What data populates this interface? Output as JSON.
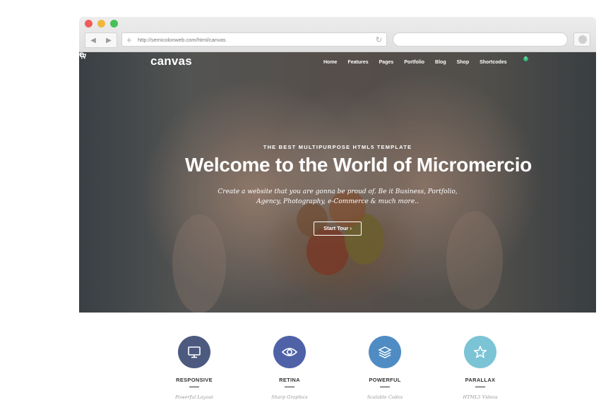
{
  "browser": {
    "url": "http://semicolonweb.com/html/canvas",
    "traffic_lights": {
      "close": "#ee5d5a",
      "minimize": "#f0b73e",
      "zoom": "#45c157"
    }
  },
  "site": {
    "logo": "canvas",
    "menu": [
      "Home",
      "Features",
      "Pages",
      "Portfolio",
      "Blog",
      "Shop",
      "Shortcodes"
    ],
    "cart_count": "5"
  },
  "hero": {
    "kicker": "THE BEST MULTIPURPOSE HTML5 TEMPLATE",
    "headline": "Welcome to the World of Micromercio",
    "subline_1": "Create a website that you are gonna be proud of. Be it Business, Portfolio,",
    "subline_2": "Agency, Photography, e-Commerce & much more..",
    "cta_label": "Start Tour",
    "cta_icon": "chevron-right-icon"
  },
  "features": [
    {
      "title": "RESPONSIVE",
      "desc": "Powerful Layout",
      "icon": "monitor-icon",
      "color": "#4d5a80"
    },
    {
      "title": "RETINA",
      "desc": "Sharp Graphics",
      "icon": "eye-icon",
      "color": "#4f62a8"
    },
    {
      "title": "POWERFUL",
      "desc": "Scalable Codes",
      "icon": "layers-icon",
      "color": "#4f8cc4"
    },
    {
      "title": "PARALLAX",
      "desc": "HTML5 Videos",
      "icon": "star-icon",
      "color": "#7bc4d6"
    }
  ]
}
